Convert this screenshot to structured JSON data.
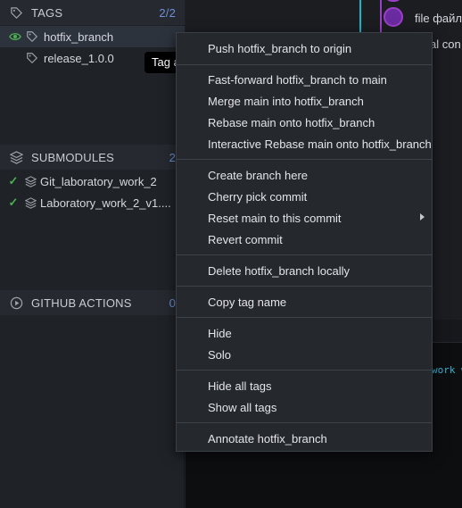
{
  "sidebar": {
    "tags": {
      "title": "TAGS",
      "count": "2/2",
      "items": [
        {
          "label": "hotfix_branch"
        },
        {
          "label": "release_1.0.0"
        }
      ]
    },
    "submodules": {
      "title": "SUBMODULES",
      "count": "2",
      "items": [
        {
          "label": "Git_laboratory_work_2"
        },
        {
          "label": "Laboratory_work_2_v1...."
        }
      ]
    },
    "github_actions": {
      "title": "GITHUB ACTIONS",
      "count": "0"
    }
  },
  "tooltip": {
    "text": "Tag a"
  },
  "graph": {
    "commit_text_1": "file файл",
    "commit_text_2": "al con",
    "console_text": "work w"
  },
  "context_menu": {
    "items": [
      {
        "label": "Push hotfix_branch to origin"
      },
      {
        "label": "Fast-forward hotfix_branch to main"
      },
      {
        "label": "Merge main into hotfix_branch"
      },
      {
        "label": "Rebase main onto hotfix_branch"
      },
      {
        "label": "Interactive Rebase main onto hotfix_branch"
      },
      {
        "label": "Create branch here"
      },
      {
        "label": "Cherry pick commit"
      },
      {
        "label": "Reset main to this commit"
      },
      {
        "label": "Revert commit"
      },
      {
        "label": "Delete hotfix_branch locally"
      },
      {
        "label": "Copy tag name"
      },
      {
        "label": "Hide"
      },
      {
        "label": "Solo"
      },
      {
        "label": "Hide all tags"
      },
      {
        "label": "Show all tags"
      },
      {
        "label": "Annotate hotfix_branch"
      }
    ]
  },
  "colors": {
    "accent_count": "#6f8fd8",
    "check_green": "#4caf50",
    "graph_cyan": "#1bb6c9",
    "graph_purple": "#9b3fc9"
  },
  "icons": [
    "tag-icon",
    "eye-icon",
    "layers-icon",
    "check-icon",
    "play-circle-icon",
    "chevron-right-icon"
  ]
}
